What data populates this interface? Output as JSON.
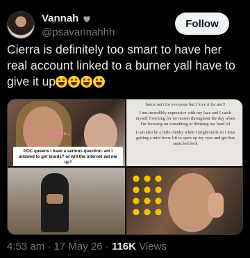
{
  "author": {
    "display_name": "Vannah",
    "handle": "@psavannahhh",
    "badge_icon": "heart-icon"
  },
  "follow_label": "Follow",
  "tweet": {
    "text": "Cierra is definitely too smart to have her real account linked to a burner yall have to give it up",
    "emoji": [
      "face-with-tears-of-joy",
      "face-with-tears-of-joy",
      "face-with-tears-of-joy",
      "face-with-tears-of-joy"
    ]
  },
  "media": {
    "tile1": {
      "overlay_text": "New Insta...",
      "caption": "POC queens I have a serious question. am I allowed to get braids? or will the internet eat me up?"
    },
    "tile2": {
      "lines": [
        "botox isn't for everyone but I love it for me!!",
        "I am incredibly expressive with my face and I catch myself frowning for no reason throughout the day when I'm focusing on something or thinking too hard lol",
        "I can also be a little chinky when I laugh/smile so I love getting a mini brow lift to open up my eyes and get that snatched look"
      ]
    }
  },
  "meta": {
    "time": "4:53 am",
    "sep1": "·",
    "date": "17 May 26",
    "sep2": "·",
    "views_count": "116K",
    "views_label": "Views"
  }
}
